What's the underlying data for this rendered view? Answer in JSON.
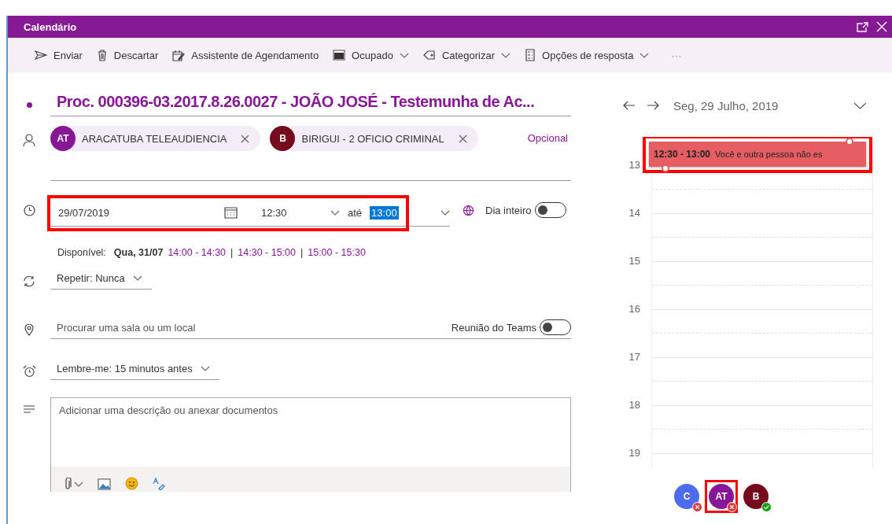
{
  "window": {
    "title": "Calendário"
  },
  "toolbar": [
    {
      "label": "Enviar",
      "dropdown": false
    },
    {
      "label": "Descartar",
      "dropdown": false
    },
    {
      "label": "Assistente de Agendamento",
      "dropdown": false
    },
    {
      "label": "Ocupado",
      "dropdown": true
    },
    {
      "label": "Categorizar",
      "dropdown": true
    },
    {
      "label": "Opções de resposta",
      "dropdown": true
    }
  ],
  "toolbar_more": "···",
  "subject": "Proc. 000396-03.2017.8.26.0027 - JOÃO JOSÉ - Testemunha de Ac...",
  "attendees": [
    {
      "initials": "AT",
      "name": "ARACATUBA TELEAUDIENCIA",
      "color": "#881798"
    },
    {
      "initials": "B",
      "name": "BIRIGUI - 2 OFICIO CRIMINAL",
      "color": "#750b1c"
    }
  ],
  "optional_link": "Opcional",
  "datetime": {
    "date": "29/07/2019",
    "start": "12:30",
    "until": "até",
    "end": "13:00",
    "end_selected": true,
    "highlighted": true
  },
  "all_day": {
    "label": "Dia inteiro",
    "on": false
  },
  "available": {
    "label": "Disponível:",
    "day": "Qua, 31/07",
    "separator": "|",
    "slots": [
      "14:00 - 14:30",
      "14:30 - 15:00",
      "15:00 - 15:30"
    ]
  },
  "repeat": {
    "label": "Repetir:",
    "value": "Nunca"
  },
  "location": {
    "placeholder": "Procurar uma sala ou um local"
  },
  "teams": {
    "label": "Reunião do Teams",
    "on": false
  },
  "reminder": {
    "label": "Lembre-me:",
    "value": "15 minutos antes"
  },
  "description": {
    "placeholder": "Adicionar uma descrição ou anexar documentos"
  },
  "calendar": {
    "date": "Seg, 29 Julho, 2019",
    "hours": [
      "13",
      "14",
      "15",
      "16",
      "17",
      "18",
      "19"
    ],
    "event": {
      "time": "12:30 - 13:00",
      "text": "Você e outra pessoa não es",
      "highlighted": true
    }
  },
  "responses": [
    {
      "initials": "C",
      "color": "#4f6bed",
      "kind": "declined",
      "highlighted": false
    },
    {
      "initials": "AT",
      "color": "#881798",
      "kind": "declined",
      "highlighted": true
    },
    {
      "initials": "B",
      "color": "#750b1c",
      "kind": "accepted",
      "highlighted": false
    }
  ]
}
